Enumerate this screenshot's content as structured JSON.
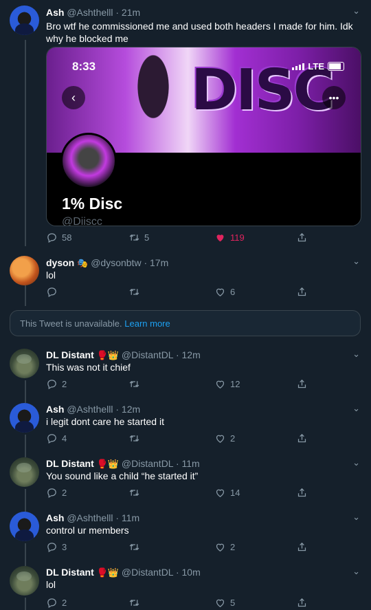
{
  "tweets": [
    {
      "name": "Ash",
      "handle": "@Ashthelll",
      "time": "· 21m",
      "text": "Bro wtf he commissioned me and used both headers I made for him. Idk why he blocked me",
      "replies": "58",
      "retweets": "5",
      "likes": "119",
      "card": {
        "status_time": "8:33",
        "network": "LTE",
        "banner_text": "DISC",
        "profile_name": "1% Disc",
        "profile_handle": "@Diiscc"
      }
    },
    {
      "name": "dyson",
      "emoji": "🎭",
      "handle": "@dysonbtw",
      "time": "· 17m",
      "text": "lol",
      "replies": "",
      "retweets": "",
      "likes": "6"
    },
    {
      "name": "DL Distant",
      "emoji": "🥊👑",
      "handle": "@DistantDL",
      "time": "· 12m",
      "text": "This was not it chief",
      "replies": "2",
      "retweets": "",
      "likes": "12"
    },
    {
      "name": "Ash",
      "handle": "@Ashthelll",
      "time": "· 12m",
      "text": "i legit dont care he started it",
      "replies": "4",
      "retweets": "",
      "likes": "2"
    },
    {
      "name": "DL Distant",
      "emoji": "🥊👑",
      "handle": "@DistantDL",
      "time": "· 11m",
      "text": "You sound like a child “he started it”",
      "replies": "2",
      "retweets": "",
      "likes": "14"
    },
    {
      "name": "Ash",
      "handle": "@Ashthelll",
      "time": "· 11m",
      "text": "control ur members",
      "replies": "3",
      "retweets": "",
      "likes": "2"
    },
    {
      "name": "DL Distant",
      "emoji": "🥊👑",
      "handle": "@DistantDL",
      "time": "· 10m",
      "text": "lol",
      "replies": "2",
      "retweets": "",
      "likes": "5"
    }
  ],
  "unavailable": {
    "text": "This Tweet is unavailable.",
    "link": "Learn more"
  },
  "colors": {
    "background": "#15202b",
    "accent": "#1da1f2",
    "like": "#e0245e",
    "secondary": "#8899a6"
  },
  "icons": [
    "reply-icon",
    "retweet-icon",
    "like-icon",
    "share-icon",
    "chevron-down-icon",
    "back-arrow-icon",
    "more-icon"
  ]
}
